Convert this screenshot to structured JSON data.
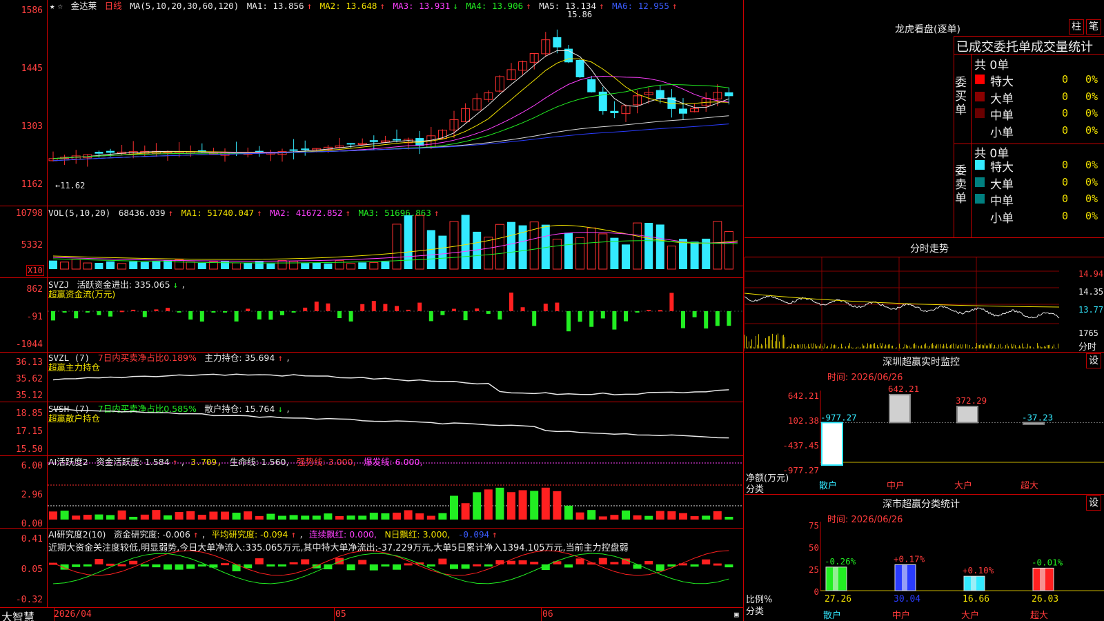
{
  "stock": {
    "name": "金达莱",
    "period": "日线",
    "ma_label": "MA(5,10,20,30,60,120)",
    "ma1": "MA1: 13.856",
    "ma2": "MA2: 13.648",
    "ma3": "MA3: 13.931",
    "ma4": "MA4: 13.906",
    "ma5": "MA5: 13.134",
    "ma6": "MA6: 12.955",
    "high_mark": "15.86",
    "low_mark": "11.62",
    "price_axis": [
      "1586",
      "1445",
      "1303",
      "1162"
    ]
  },
  "vol": {
    "label": "VOL(5,10,20)",
    "value": "68436.039",
    "ma1": "MA1: 51740.047",
    "ma2": "MA2: 41672.852",
    "ma3": "MA3: 51696.863",
    "axis": [
      "10798",
      "5332"
    ],
    "unit": "X10"
  },
  "svzj": {
    "label": "SVZJ",
    "active": "活跃资金进出: 335.065",
    "sub": "超赢资金流(万元)",
    "axis": [
      "862",
      "-91",
      "-1044"
    ]
  },
  "svzl": {
    "label": "SVZL (7)",
    "ratio": "7日内买卖净占比0.189%",
    "hold": "主力持仓: 35.694",
    "sub": "超赢主力持仓",
    "axis": [
      "36.13",
      "35.62",
      "35.12"
    ]
  },
  "svsh": {
    "label": "SVSH (7)",
    "ratio": "7日内买卖净占比0.585%",
    "hold": "散户持仓: 15.764",
    "sub": "超赢散户持仓",
    "axis": [
      "18.85",
      "17.15",
      "15.50"
    ]
  },
  "ai_active": {
    "label": "AI活跃度2",
    "fund": "资金活跃度: 1.584",
    "v2": "3.709,",
    "life": "生命线: 1.560,",
    "strong": "强势线: 3.000,",
    "burst": "爆发线: 6.000,",
    "axis": [
      "6.00",
      "2.96",
      "0.00"
    ]
  },
  "ai_research": {
    "label": "AI研究度2(10)",
    "fund": "资金研究度: -0.006",
    "avg": "平均研究度: -0.094",
    "cont": "连续飘红: 0.000,",
    "n": "N日飘红: 3.000,",
    "v": "-0.094",
    "comment": "近期大资金关注度较低,明显弱势,今日大单净流入:335.065万元,其中特大单净流出:-37.229万元,大单5日累计净入1394.105万元,当前主力控盘弱",
    "axis": [
      "0.41",
      "0.05",
      "-0.32"
    ]
  },
  "date_axis": {
    "app": "大智慧",
    "d1": "2026/04",
    "d2": "05",
    "d3": "06"
  },
  "right": {
    "lhb_title": "龙虎看盘(逐单)",
    "btn_zhu": "柱",
    "btn_bi": "笔",
    "tabs": [
      "已成交",
      "委托单",
      "成交量统计"
    ],
    "buy_label": "委买单",
    "sell_label": "委卖单",
    "buy_total": "共 0单",
    "sell_total": "共 0单",
    "rows": [
      {
        "name": "特大",
        "count": "0",
        "pct": "0%"
      },
      {
        "name": "大单",
        "count": "0",
        "pct": "0%"
      },
      {
        "name": "中单",
        "count": "0",
        "pct": "0%"
      },
      {
        "name": "小单",
        "count": "0",
        "pct": "0%"
      }
    ],
    "intraday_title": "分时走势",
    "intraday_axis": [
      "14.94",
      "14.35",
      "13.77"
    ],
    "intraday_vol": "1765",
    "intraday_sub": "分时",
    "sz_monitor_title": "深圳超赢实时监控",
    "sz_set": "设",
    "time1": "时间: 2026/06/26",
    "net_axis": [
      "642.21",
      "102.38",
      "-437.45",
      "-977.27"
    ],
    "net_label": "净额(万元)",
    "cat_label": "分类",
    "categories": [
      "散户",
      "中户",
      "大户",
      "超大"
    ],
    "net_values": [
      "-977.27",
      "642.21",
      "372.29",
      "-37.23"
    ],
    "sz_class_title": "深市超赢分类统计",
    "time2": "时间: 2026/06/26",
    "pct_axis": [
      "75",
      "50",
      "25",
      "0"
    ],
    "pct_label": "比例%",
    "pct_changes": [
      "-0.26%",
      "+0.17%",
      "+0.10%",
      "-0.01%"
    ],
    "pct_values": [
      "27.26",
      "30.04",
      "16.66",
      "26.03"
    ]
  },
  "chart_data": {
    "type": "bar",
    "title": "深圳超赢实时监控",
    "categories": [
      "散户",
      "中户",
      "大户",
      "超大"
    ],
    "series": [
      {
        "values": [
          -977.27,
          642.21,
          372.29,
          -37.23
        ]
      }
    ],
    "ylabel": "净额(万元)",
    "ylim": [
      -977.27,
      642.21
    ]
  }
}
